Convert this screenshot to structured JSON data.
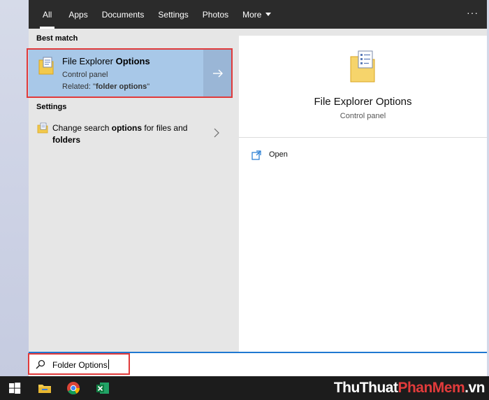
{
  "tabs": [
    {
      "label": "All",
      "active": true
    },
    {
      "label": "Apps"
    },
    {
      "label": "Documents"
    },
    {
      "label": "Settings"
    },
    {
      "label": "Photos"
    },
    {
      "label": "More"
    }
  ],
  "overflow_label": "···",
  "results": {
    "best_match_heading": "Best match",
    "best_match": {
      "title_plain": "File Explorer ",
      "title_bold": "Options",
      "subtitle": "Control panel",
      "related_prefix": "Related: \"",
      "related_bold": "folder options",
      "related_suffix": "\""
    },
    "settings_heading": "Settings",
    "settings_item": {
      "text_1": "Change search ",
      "text_bold_1": "options",
      "text_2": " for files and ",
      "text_bold_2": "folders"
    }
  },
  "preview": {
    "title": "File Explorer Options",
    "subtitle": "Control panel",
    "open_label": "Open"
  },
  "search": {
    "query": "Folder Options"
  },
  "watermark": {
    "part_a": "ThuThuat",
    "part_b": "PhanMem",
    "part_c": ".vn"
  },
  "colors": {
    "topbar": "#2b2b2b",
    "selected": "#a8c8e8",
    "highlight_border": "#e03a3a",
    "search_accent": "#1f78d1"
  },
  "icons": [
    "windows-logo-icon",
    "file-explorer-icon",
    "chrome-icon",
    "excel-icon",
    "search-icon",
    "open-icon",
    "folder-options-icon",
    "chevron-right-icon",
    "arrow-right-icon"
  ]
}
